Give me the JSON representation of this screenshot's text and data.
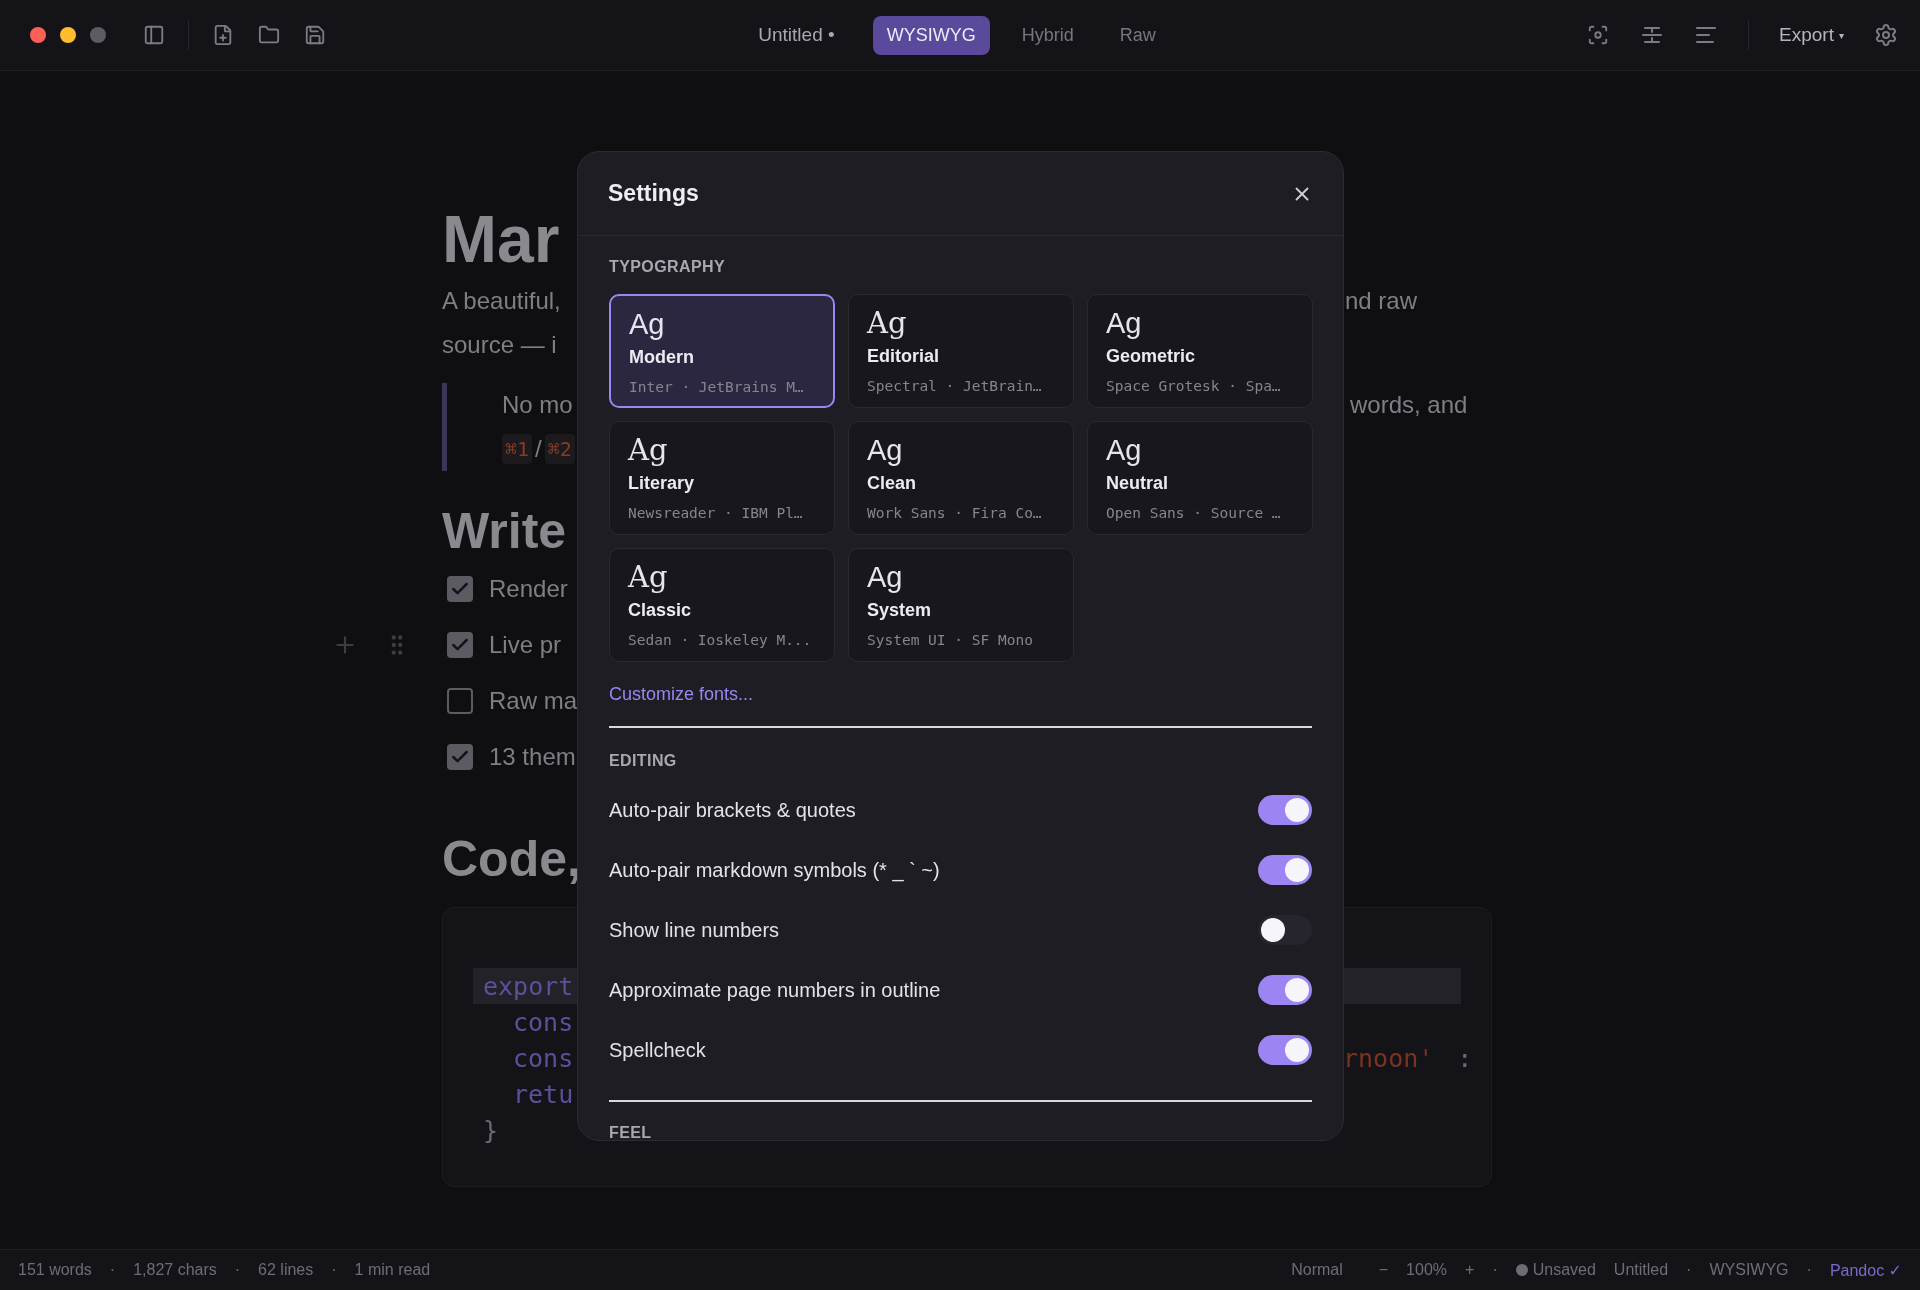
{
  "titlebar": {
    "title": "Untitled",
    "dirty_mark": "•",
    "modes": [
      {
        "label": "WYSIWYG",
        "selected": true
      },
      {
        "label": "Hybrid",
        "selected": false
      },
      {
        "label": "Raw",
        "selected": false
      }
    ],
    "export": {
      "label": "Export",
      "caret": "▾"
    }
  },
  "document": {
    "title": "Mar",
    "intro": [
      {
        "left": "A beautiful,",
        "right": "nd raw"
      },
      {
        "left": "source — i"
      }
    ],
    "quote": {
      "left": "No mo",
      "right": "words, and",
      "keys": [
        "⌘1",
        "⌘2"
      ],
      "key_separator": "/"
    },
    "tasks_heading": "Write",
    "tasks": [
      {
        "text": "Render",
        "checked": true
      },
      {
        "text": "Live pr",
        "checked": true,
        "hovered": true
      },
      {
        "text": "Raw ma",
        "checked": false
      },
      {
        "text": "13 them",
        "checked": true
      }
    ],
    "code_heading": "Code,",
    "code": [
      {
        "text": "export",
        "indent": false,
        "current": true
      },
      {
        "text": "cons",
        "indent": true,
        "current": false
      },
      {
        "text": "cons",
        "indent": true,
        "current": false,
        "string": "rnoon'",
        "punct": ":"
      },
      {
        "text": "retu",
        "indent": true,
        "current": false
      },
      {
        "text": "}",
        "indent": false,
        "current": false,
        "kind": "brace"
      }
    ]
  },
  "settings": {
    "title": "Settings",
    "typography": {
      "label": "TYPOGRAPHY",
      "presets": [
        {
          "sample": "Ag",
          "name": "Modern",
          "fonts": "Inter · JetBrains M…",
          "kind": "sans",
          "selected": true
        },
        {
          "sample": "Ag",
          "name": "Editorial",
          "fonts": "Spectral · JetBrain…",
          "kind": "serif",
          "selected": false
        },
        {
          "sample": "Ag",
          "name": "Geometric",
          "fonts": "Space Grotesk · Spa…",
          "kind": "sans",
          "selected": false
        },
        {
          "sample": "Ag",
          "name": "Literary",
          "fonts": "Newsreader · IBM Pl…",
          "kind": "serif",
          "selected": false
        },
        {
          "sample": "Ag",
          "name": "Clean",
          "fonts": "Work Sans · Fira Co…",
          "kind": "sans",
          "selected": false
        },
        {
          "sample": "Ag",
          "name": "Neutral",
          "fonts": "Open Sans · Source …",
          "kind": "sans",
          "selected": false
        },
        {
          "sample": "Ag",
          "name": "Classic",
          "fonts": "Sedan · Ioskeley M...",
          "kind": "serif",
          "selected": false
        },
        {
          "sample": "Ag",
          "name": "System",
          "fonts": "System UI · SF Mono",
          "kind": "sans",
          "selected": false
        }
      ],
      "link": "Customize fonts..."
    },
    "editing": {
      "label": "EDITING",
      "options": [
        {
          "label": "Auto-pair brackets & quotes",
          "on": true
        },
        {
          "label": "Auto-pair markdown symbols (* _ ` ~)",
          "on": true
        },
        {
          "label": "Show line numbers",
          "on": false
        },
        {
          "label": "Approximate page numbers in outline",
          "on": true
        },
        {
          "label": "Spellcheck",
          "on": true
        }
      ]
    },
    "feel": {
      "label": "FEEL"
    }
  },
  "status_bar": {
    "separator": "·",
    "stats": [
      "151 words",
      "1,827 chars",
      "62 lines",
      "1 min read"
    ],
    "zoom": {
      "mode": "Normal",
      "minus": "−",
      "value": "100%",
      "plus": "+"
    },
    "save_state": {
      "label": "Unsaved",
      "saved": false
    },
    "file": "Untitled",
    "mode": "WYSIWYG",
    "converter": "Pandoc ✓"
  }
}
